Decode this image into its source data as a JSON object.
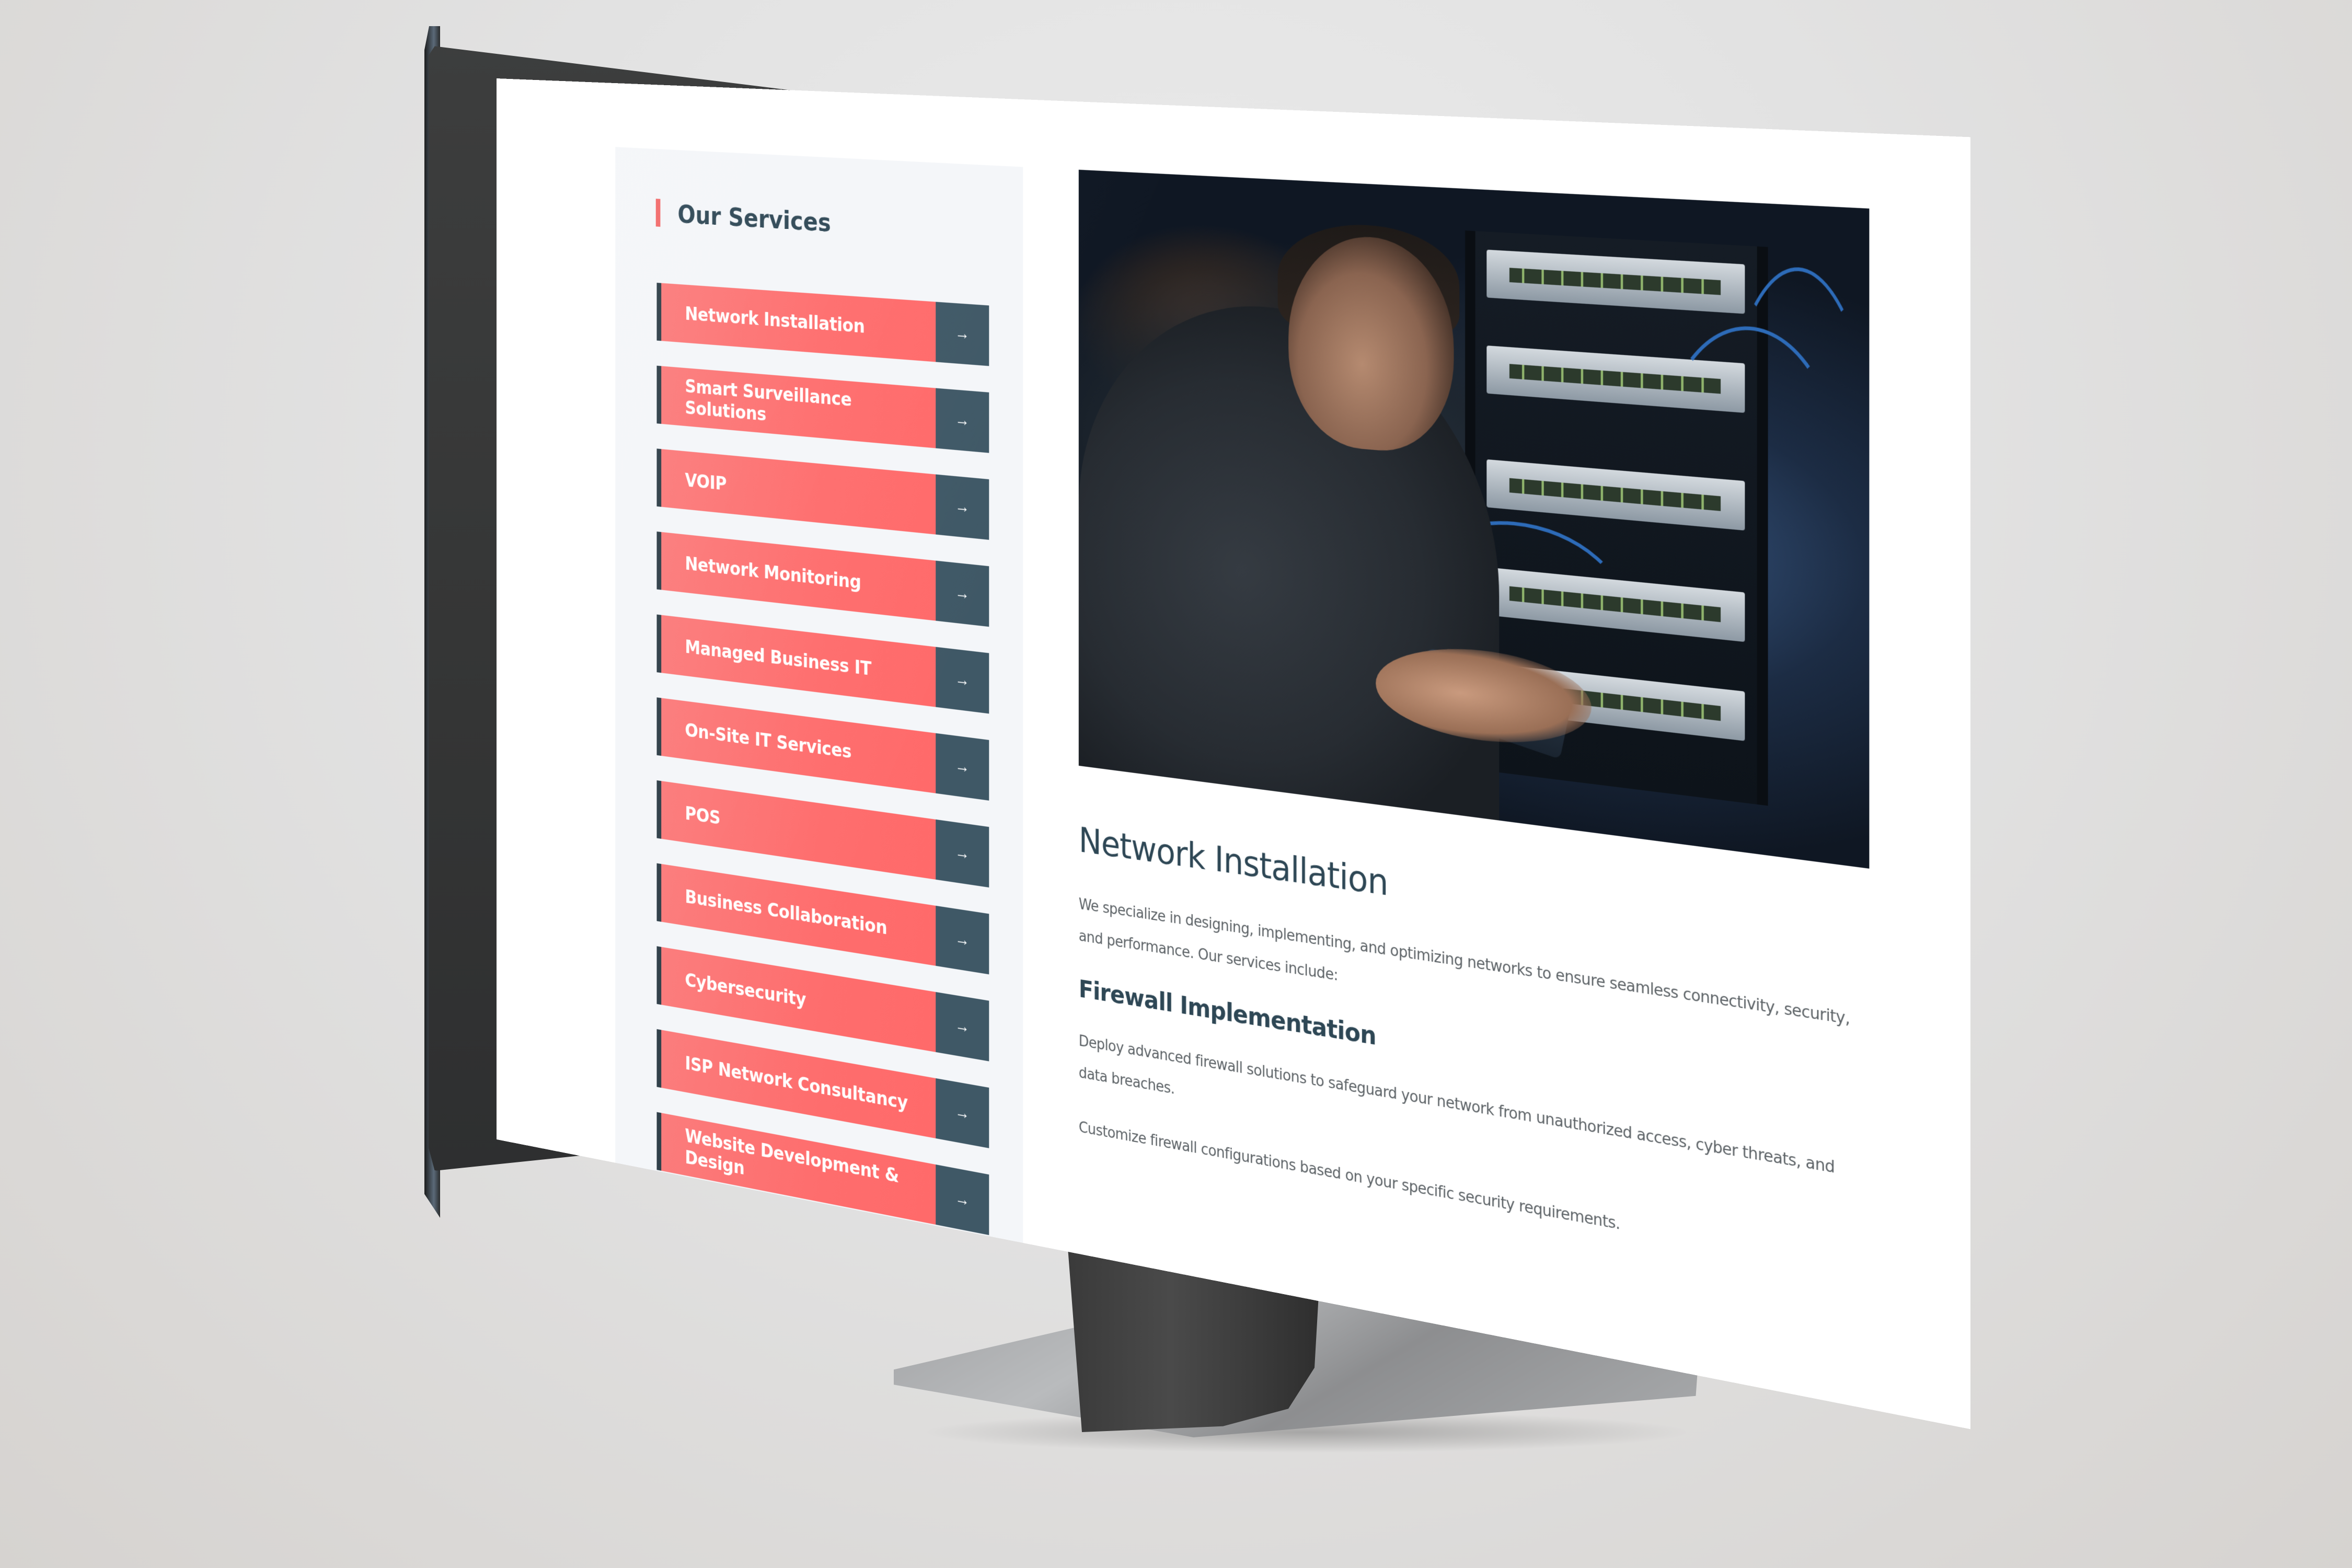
{
  "sidebar": {
    "title": "Our Services",
    "arrow_glyph": "→",
    "items": [
      {
        "label": "Network Installation"
      },
      {
        "label": "Smart Surveillance Solutions"
      },
      {
        "label": "VOIP"
      },
      {
        "label": "Network Monitoring"
      },
      {
        "label": "Managed Business IT"
      },
      {
        "label": "On-Site IT Services"
      },
      {
        "label": "POS"
      },
      {
        "label": "Business Collaboration"
      },
      {
        "label": "Cybersecurity"
      },
      {
        "label": "ISP Network Consultancy"
      },
      {
        "label": "Website Development & Design"
      }
    ]
  },
  "main": {
    "hero_image_alt": "Technician working on server rack network cabling",
    "title": "Network Installation",
    "intro": "We specialize in designing, implementing, and optimizing networks to ensure seamless connectivity, security, and performance. Our services include:",
    "sections": [
      {
        "title": "Firewall Implementation",
        "paragraphs": [
          "Deploy advanced firewall solutions to safeguard your network from unauthorized access, cyber threats, and data breaches.",
          "Customize firewall configurations based on your specific security requirements."
        ]
      }
    ]
  },
  "colors": {
    "accent_red": "#ff6b6b",
    "dark_slate": "#3f5866",
    "heading": "#2e4755",
    "sidebar_bg": "#f4f6f9"
  }
}
